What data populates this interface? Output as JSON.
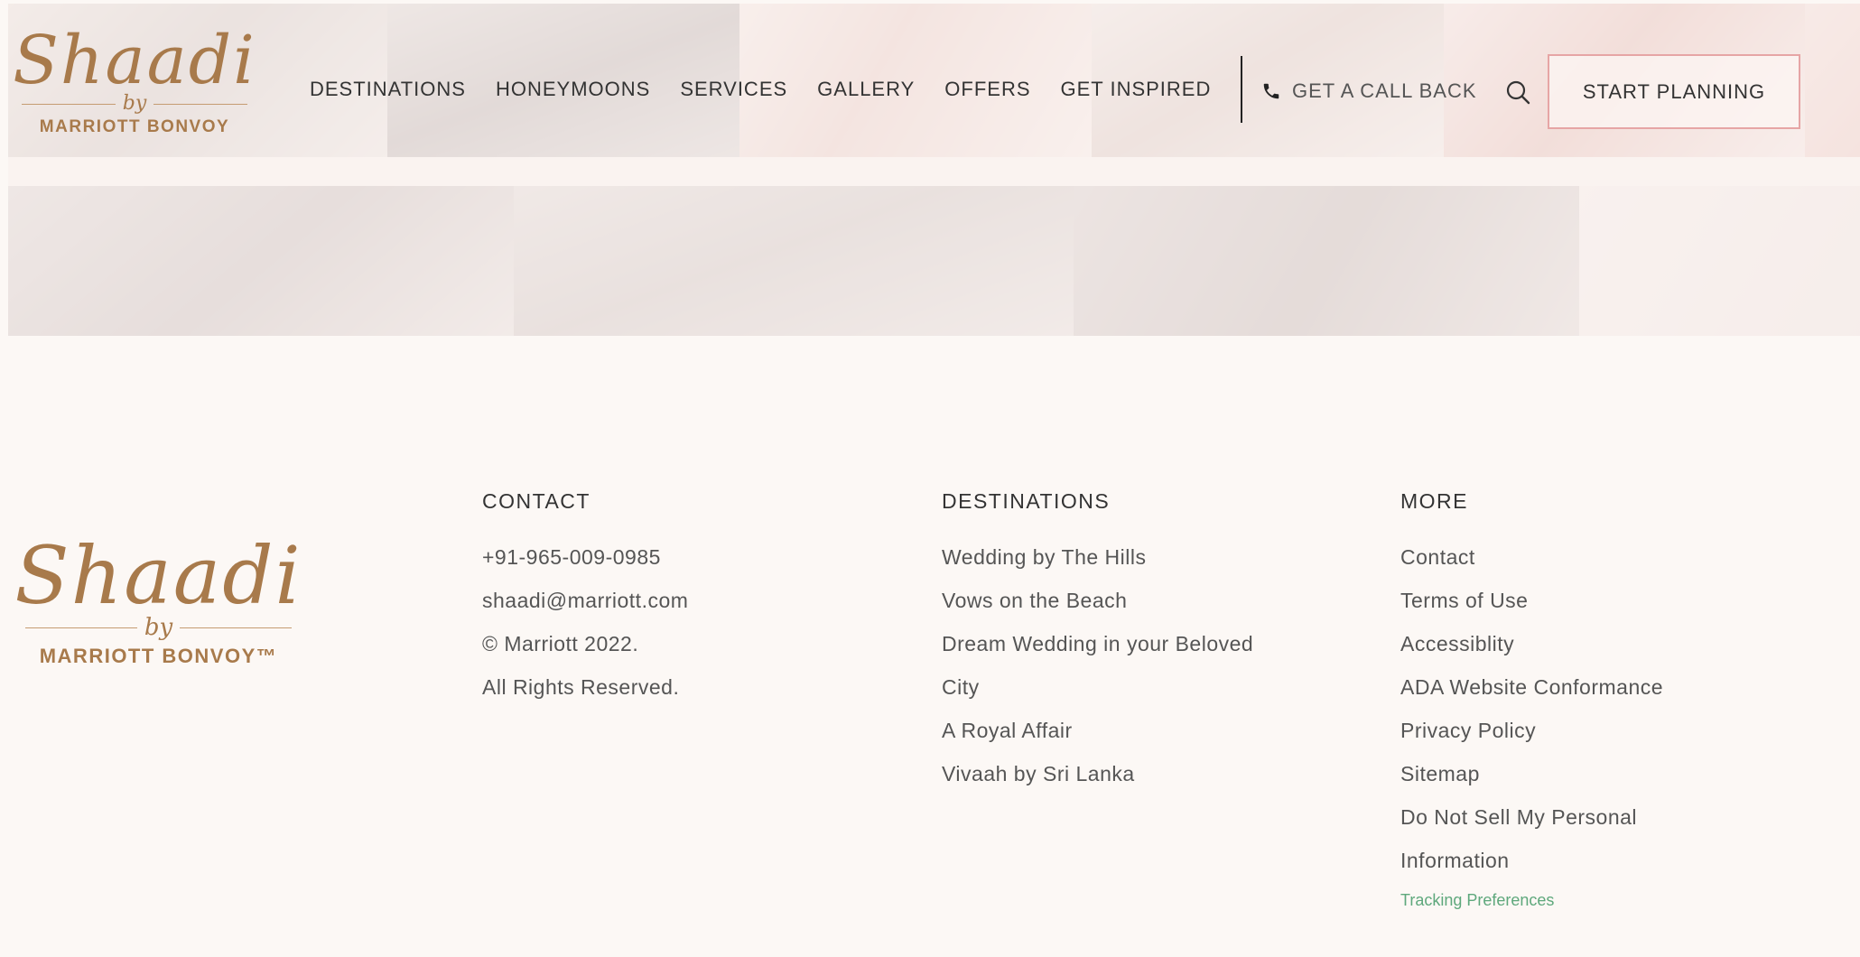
{
  "header": {
    "logo": {
      "script": "Shaadi",
      "by": "by",
      "brand": "MARRIOTT BONVOY"
    },
    "nav": [
      "DESTINATIONS",
      "HONEYMOONS",
      "SERVICES",
      "GALLERY",
      "OFFERS",
      "GET INSPIRED"
    ],
    "callback_label": "GET A CALL BACK",
    "cta_label": "START PLANNING"
  },
  "footer": {
    "logo": {
      "script": "Shaadi",
      "by": "by",
      "brand": "MARRIOTT BONVOY™"
    },
    "contact": {
      "heading": "CONTACT",
      "phone": "+91-965-009-0985",
      "email": "shaadi@marriott.com",
      "copyright": "© Marriott 2022.",
      "rights": "All Rights Reserved."
    },
    "destinations": {
      "heading": "DESTINATIONS",
      "items": [
        "Wedding by The Hills",
        "Vows on the Beach",
        "Dream Wedding in your Beloved",
        "City",
        "A Royal Affair",
        "Vivaah by Sri Lanka"
      ]
    },
    "more": {
      "heading": "MORE",
      "items": [
        "Contact",
        "Terms of Use",
        "Accessiblity",
        "ADA Website Conformance",
        "Privacy Policy",
        "Sitemap",
        "Do Not Sell My Personal",
        "Information"
      ],
      "tracking": "Tracking Preferences"
    }
  },
  "colors": {
    "brand_gold": "#a87a4b",
    "cta_border": "#e6a5a5",
    "tracking_green": "#5ea87c",
    "background": "#fcf8f5"
  },
  "icons": [
    "phone-icon",
    "search-icon"
  ]
}
